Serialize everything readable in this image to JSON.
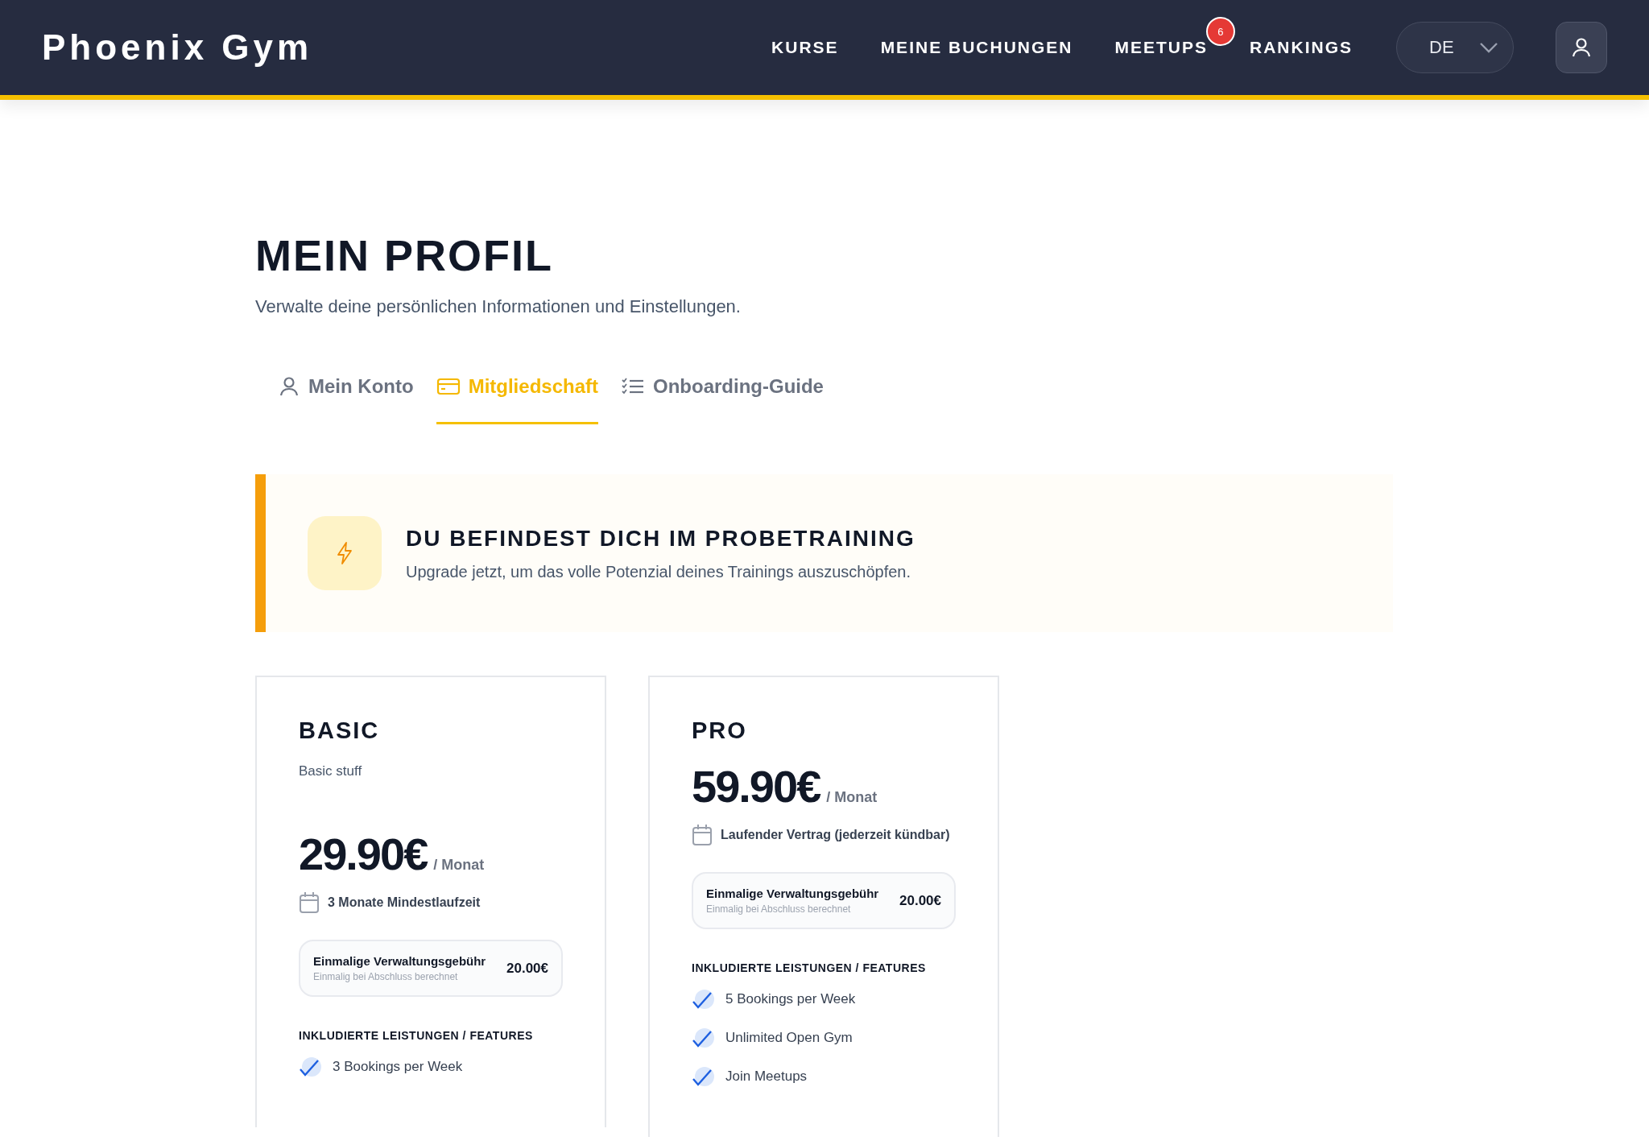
{
  "header": {
    "logo": "Phoenix Gym",
    "nav": [
      {
        "label": "KURSE"
      },
      {
        "label": "MEINE BUCHUNGEN"
      },
      {
        "label": "MEETUPS",
        "badge": "6"
      },
      {
        "label": "RANKINGS"
      }
    ],
    "language": {
      "value": "DE"
    }
  },
  "page": {
    "title": "MEIN PROFIL",
    "subtitle": "Verwalte deine persönlichen Informationen und Einstellungen."
  },
  "tabs": [
    {
      "label": "Mein Konto",
      "kind": "account",
      "selected": false
    },
    {
      "label": "Mitgliedschaft",
      "kind": "membership",
      "selected": true
    },
    {
      "label": "Onboarding-Guide",
      "kind": "guide",
      "selected": false
    }
  ],
  "banner": {
    "title": "DU BEFINDEST DICH IM PROBETRAINING",
    "text": "Upgrade jetzt, um das volle Potenzial deines Trainings auszuschöpfen."
  },
  "plans": [
    {
      "name": "BASIC",
      "description": "Basic stuff",
      "price": "29.90€",
      "period": "/ Monat",
      "term": "3 Monate Mindestlaufzeit",
      "fee": {
        "title": "Einmalige Verwaltungsgebühr",
        "note": "Einmalig bei Abschluss berechnet",
        "amount": "20.00€"
      },
      "features_heading": "INKLUDIERTE LEISTUNGEN / FEATURES",
      "features": [
        "3 Bookings per Week"
      ]
    },
    {
      "name": "PRO",
      "price": "59.90€",
      "period": "/ Monat",
      "term": "Laufender Vertrag (jederzeit kündbar)",
      "fee": {
        "title": "Einmalige Verwaltungsgebühr",
        "note": "Einmalig bei Abschluss berechnet",
        "amount": "20.00€"
      },
      "features_heading": "INKLUDIERTE LEISTUNGEN / FEATURES",
      "features": [
        "5 Bookings per Week",
        "Unlimited Open Gym",
        "Join Meetups"
      ]
    }
  ]
}
